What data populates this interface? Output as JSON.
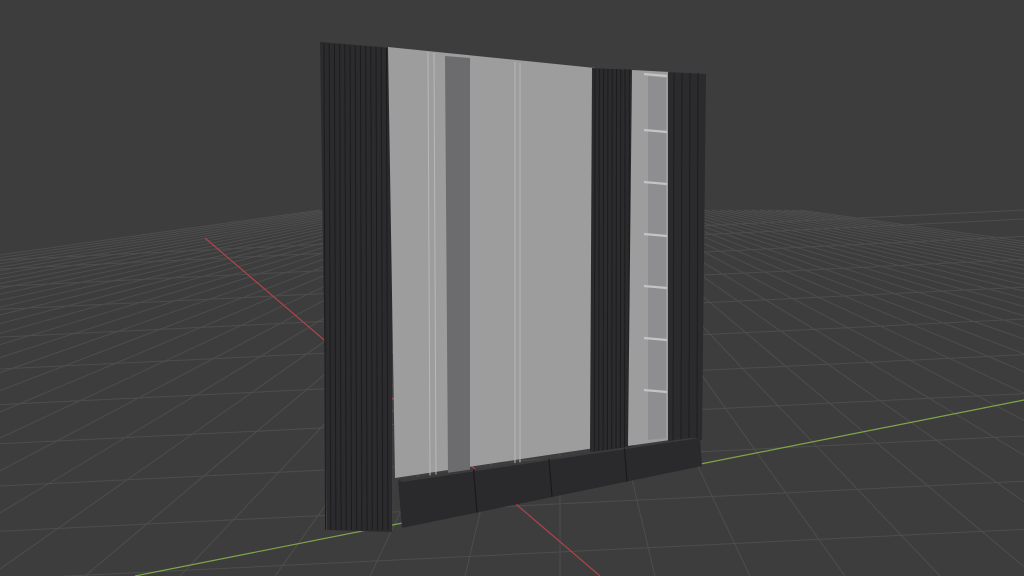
{
  "app": "3D viewport",
  "viewport": {
    "background_color": "#3d3d3d",
    "grid_color": "#4d4d4d",
    "axis_x_color": "#b0434a",
    "axis_y_color": "#7fa64a"
  },
  "model": {
    "panel_dark_color": "#2b2b2d",
    "panel_light_color": "#9d9d9e",
    "shelf_edge_color": "#c4c4c4",
    "drawer_color": "#2a2a2c",
    "shelf_count": 7,
    "drawer_count": 4
  }
}
